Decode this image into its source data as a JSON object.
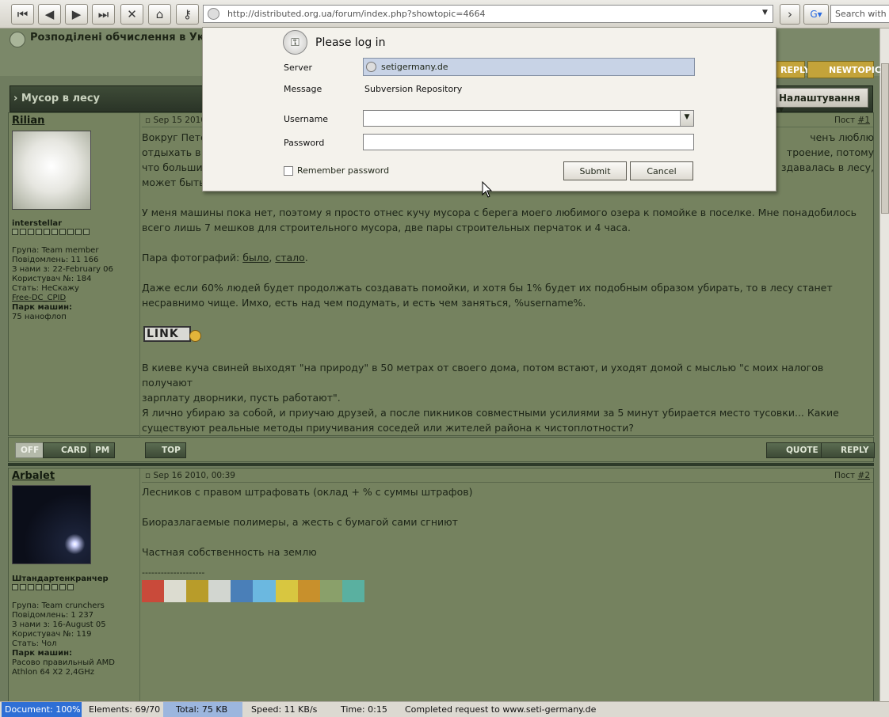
{
  "browser": {
    "url": "http://distributed.org.ua/forum/index.php?showtopic=4664",
    "search_placeholder": "Search with Go"
  },
  "forum": {
    "site_title": "Розподілені обчислення в Укра",
    "reply_label": "REPLY",
    "newtopic_label": "NEWTOPIC",
    "topic_title": "› Мусор в лесу",
    "options_label": "Налаштування ▾"
  },
  "posts": [
    {
      "author": "Rilian",
      "rank": "interstellar",
      "stats": [
        "Група: Team member",
        "Повідомлень: 11 166",
        "З нами з: 22-February 06",
        "Користувач №: 184",
        "Стать: НеСкажу"
      ],
      "link_line": "Free-DC_CPID",
      "machines_label": "Парк машин:",
      "machines": "75 нанофлоп",
      "date": "Sep 15 2010",
      "number_prefix": "Пост ",
      "number": "#1",
      "paragraphs": [
        [
          "Вокруг Пете",
          "ченъ люблю"
        ],
        [
          "отдыхать в",
          "троение, потому"
        ],
        [
          "что больши",
          "здавалась в лесу,"
        ],
        [
          "может быть",
          ""
        ]
      ],
      "body": [
        "У меня машины пока нет, поэтому я просто отнес кучу мусора с берега моего любимого озера к помойке в поселке. Мне понадобилось",
        "всего лишь 7 мешков для строительного мусора, две пары строительных перчаток и 4 часа."
      ],
      "photos_prefix": "Пара фотографий: ",
      "photo_link_1": "было",
      "photo_sep": ", ",
      "photo_link_2": "стало",
      "photo_end": ".",
      "body2": [
        "Даже если 60% людей будет продолжать создавать помойки, и хотя бы 1% будет их подобным образом убирать, то в лесу станет",
        "несравнимо чище. Имхо, есть над чем подумать, и есть чем заняться, %username%."
      ],
      "link_badge": "LINK",
      "body3": [
        "В киеве куча свиней выходят \"на природу\" в 50 метрах от своего дома, потом встают, и уходят домой с мыслью \"с моих налогов получают",
        "зарплату дворники, пусть работают\"."
      ],
      "body4": [
        "Я лично убираю за собой, и приучаю друзей, а после пикников совместными усилиями за 5 минут убирается место тусовки... Какие",
        "существуют реальные методы приучивания соседей или жителей района к чистоплотности?"
      ]
    },
    {
      "author": "Arbalet",
      "rank": "Штандартенкранчер",
      "stats": [
        "Група: Team crunchers",
        "Повідомлень: 1 237",
        "З нами з: 16-August 05",
        "Користувач №: 119",
        "Стать: Чол"
      ],
      "machines_label": "Парк машин:",
      "machines": "Расово правильный AMD",
      "machines2": "Athlon 64 X2 2,4GHz",
      "date": "Sep 16 2010, 00:39",
      "number_prefix": "Пост ",
      "number": "#2",
      "body": [
        "Лесников с правом штрафовать (оклад + % с суммы штрафов)",
        "Биоразлагаемые полимеры, а жесть с бумагой сами сгниют",
        "Частная собственность на землю"
      ],
      "separator": "--------------------"
    }
  ],
  "footer_buttons": {
    "off": "OFF",
    "card": "CARD",
    "pm": "PM",
    "top": "TOP",
    "quote": "QUOTE",
    "reply": "REPLY"
  },
  "dialog": {
    "title": "Please log in",
    "server_label": "Server",
    "server_value": "setigermany.de",
    "message_label": "Message",
    "message_value": "Subversion Repository",
    "username_label": "Username",
    "password_label": "Password",
    "remember_label": "Remember password",
    "submit_label": "Submit",
    "cancel_label": "Cancel"
  },
  "status": {
    "document": "Document:  100%",
    "elements": "Elements:  69/70",
    "total": "Total:  75 KB",
    "speed": "Speed:  11 KB/s",
    "time": "Time:  0:15",
    "message": "Completed request to www.seti-germany.de"
  },
  "colors": {
    "accent": "#c3a33a",
    "dialog_bg": "#f4f2ec",
    "page_bg": "#75825f"
  }
}
